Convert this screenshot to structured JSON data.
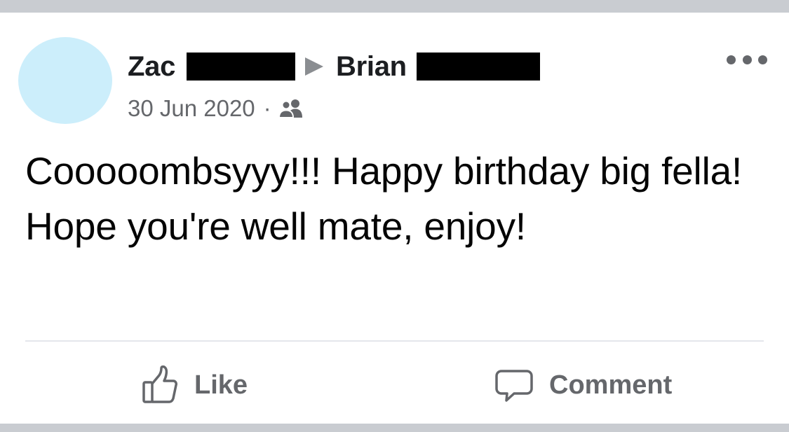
{
  "post": {
    "author": "Zac",
    "target": "Brian",
    "date": "30 Jun 2020",
    "separator": "·",
    "audience_icon": "friends-icon",
    "text": "Cooooombsyyy!!! Happy birthday big fella! Hope you're well mate, enjoy!"
  },
  "actions": {
    "like_label": "Like",
    "like_icon": "thumbs-up-icon",
    "comment_label": "Comment",
    "comment_icon": "speech-bubble-icon"
  },
  "menu_icon": "more-options-icon",
  "colors": {
    "avatar": "#cceefb",
    "band": "#c9ccd1",
    "secondary_text": "#65676b",
    "primary_text": "#050505",
    "redaction": "#000000"
  }
}
